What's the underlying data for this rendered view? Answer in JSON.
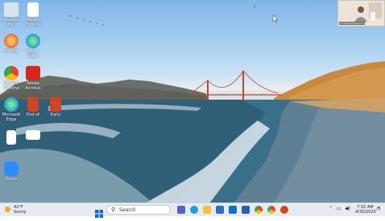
{
  "desktop_icons": [
    {
      "name": "recycle-bin-icon",
      "label": "Recycle Bin",
      "color": "#d9e3ea"
    },
    {
      "name": "word-document-icon",
      "label": "Work - Chrome",
      "color": "#ffffff"
    },
    {
      "name": "firefox-icon",
      "label": "Firefox",
      "color": "#ff7139"
    },
    {
      "name": "edge-icon",
      "label": "Work - Edge",
      "color": "#1ea0d8"
    },
    {
      "name": "chrome-icon",
      "label": "Google Chrome",
      "color": "#e94235"
    },
    {
      "name": "adobe-acrobat-icon",
      "label": "Adobe Acrobat",
      "color": "#d7261e"
    },
    {
      "name": "edge-icon",
      "label": "Microsoft Edge",
      "color": "#1ea0d8"
    },
    {
      "name": "powerpoint-icon",
      "label": "End of",
      "color": "#d04423"
    },
    {
      "name": "powerpoint-icon",
      "label": "Early",
      "color": "#d04423"
    },
    {
      "name": "file-icon",
      "label": "",
      "color": "#ffffff"
    },
    {
      "name": "file-icon",
      "label": "",
      "color": "#ffffff"
    },
    {
      "name": "zoom-icon",
      "label": "Zoom",
      "color": "#2d8cff"
    }
  ],
  "camera_overlay": {
    "caption": "Conference Room 1"
  },
  "taskbar": {
    "weather": {
      "temp": "42°F",
      "condition": "Sunny"
    },
    "search_placeholder": "Search",
    "time": "7:32 AM",
    "date": "4/30/2025"
  }
}
